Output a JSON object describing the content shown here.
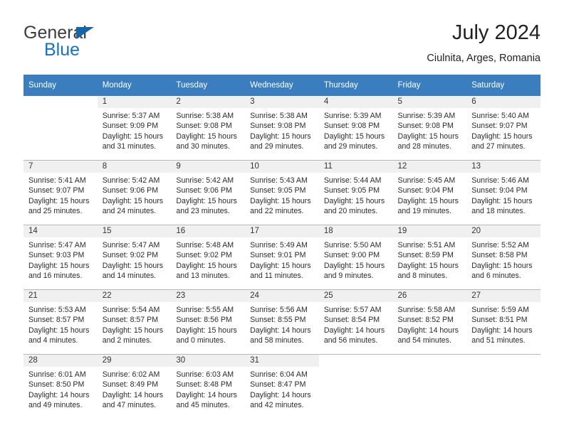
{
  "brand": {
    "name_part1": "General",
    "name_part2": "Blue",
    "flag_icon": "triangle-pennant-icon"
  },
  "header": {
    "title": "July 2024",
    "subtitle": "Ciulnita, Arges, Romania"
  },
  "colors": {
    "header_blue": "#3a7ebf",
    "brand_blue": "#1872bb",
    "daynum_band": "#f0f0f0",
    "row_divider": "#b9b9b9"
  },
  "weekday_headers": [
    "Sunday",
    "Monday",
    "Tuesday",
    "Wednesday",
    "Thursday",
    "Friday",
    "Saturday"
  ],
  "weeks": [
    [
      {
        "day": "",
        "lines": []
      },
      {
        "day": "1",
        "lines": [
          "Sunrise: 5:37 AM",
          "Sunset: 9:09 PM",
          "Daylight: 15 hours",
          "and 31 minutes."
        ]
      },
      {
        "day": "2",
        "lines": [
          "Sunrise: 5:38 AM",
          "Sunset: 9:08 PM",
          "Daylight: 15 hours",
          "and 30 minutes."
        ]
      },
      {
        "day": "3",
        "lines": [
          "Sunrise: 5:38 AM",
          "Sunset: 9:08 PM",
          "Daylight: 15 hours",
          "and 29 minutes."
        ]
      },
      {
        "day": "4",
        "lines": [
          "Sunrise: 5:39 AM",
          "Sunset: 9:08 PM",
          "Daylight: 15 hours",
          "and 29 minutes."
        ]
      },
      {
        "day": "5",
        "lines": [
          "Sunrise: 5:39 AM",
          "Sunset: 9:08 PM",
          "Daylight: 15 hours",
          "and 28 minutes."
        ]
      },
      {
        "day": "6",
        "lines": [
          "Sunrise: 5:40 AM",
          "Sunset: 9:07 PM",
          "Daylight: 15 hours",
          "and 27 minutes."
        ]
      }
    ],
    [
      {
        "day": "7",
        "lines": [
          "Sunrise: 5:41 AM",
          "Sunset: 9:07 PM",
          "Daylight: 15 hours",
          "and 25 minutes."
        ]
      },
      {
        "day": "8",
        "lines": [
          "Sunrise: 5:42 AM",
          "Sunset: 9:06 PM",
          "Daylight: 15 hours",
          "and 24 minutes."
        ]
      },
      {
        "day": "9",
        "lines": [
          "Sunrise: 5:42 AM",
          "Sunset: 9:06 PM",
          "Daylight: 15 hours",
          "and 23 minutes."
        ]
      },
      {
        "day": "10",
        "lines": [
          "Sunrise: 5:43 AM",
          "Sunset: 9:05 PM",
          "Daylight: 15 hours",
          "and 22 minutes."
        ]
      },
      {
        "day": "11",
        "lines": [
          "Sunrise: 5:44 AM",
          "Sunset: 9:05 PM",
          "Daylight: 15 hours",
          "and 20 minutes."
        ]
      },
      {
        "day": "12",
        "lines": [
          "Sunrise: 5:45 AM",
          "Sunset: 9:04 PM",
          "Daylight: 15 hours",
          "and 19 minutes."
        ]
      },
      {
        "day": "13",
        "lines": [
          "Sunrise: 5:46 AM",
          "Sunset: 9:04 PM",
          "Daylight: 15 hours",
          "and 18 minutes."
        ]
      }
    ],
    [
      {
        "day": "14",
        "lines": [
          "Sunrise: 5:47 AM",
          "Sunset: 9:03 PM",
          "Daylight: 15 hours",
          "and 16 minutes."
        ]
      },
      {
        "day": "15",
        "lines": [
          "Sunrise: 5:47 AM",
          "Sunset: 9:02 PM",
          "Daylight: 15 hours",
          "and 14 minutes."
        ]
      },
      {
        "day": "16",
        "lines": [
          "Sunrise: 5:48 AM",
          "Sunset: 9:02 PM",
          "Daylight: 15 hours",
          "and 13 minutes."
        ]
      },
      {
        "day": "17",
        "lines": [
          "Sunrise: 5:49 AM",
          "Sunset: 9:01 PM",
          "Daylight: 15 hours",
          "and 11 minutes."
        ]
      },
      {
        "day": "18",
        "lines": [
          "Sunrise: 5:50 AM",
          "Sunset: 9:00 PM",
          "Daylight: 15 hours",
          "and 9 minutes."
        ]
      },
      {
        "day": "19",
        "lines": [
          "Sunrise: 5:51 AM",
          "Sunset: 8:59 PM",
          "Daylight: 15 hours",
          "and 8 minutes."
        ]
      },
      {
        "day": "20",
        "lines": [
          "Sunrise: 5:52 AM",
          "Sunset: 8:58 PM",
          "Daylight: 15 hours",
          "and 6 minutes."
        ]
      }
    ],
    [
      {
        "day": "21",
        "lines": [
          "Sunrise: 5:53 AM",
          "Sunset: 8:57 PM",
          "Daylight: 15 hours",
          "and 4 minutes."
        ]
      },
      {
        "day": "22",
        "lines": [
          "Sunrise: 5:54 AM",
          "Sunset: 8:57 PM",
          "Daylight: 15 hours",
          "and 2 minutes."
        ]
      },
      {
        "day": "23",
        "lines": [
          "Sunrise: 5:55 AM",
          "Sunset: 8:56 PM",
          "Daylight: 15 hours",
          "and 0 minutes."
        ]
      },
      {
        "day": "24",
        "lines": [
          "Sunrise: 5:56 AM",
          "Sunset: 8:55 PM",
          "Daylight: 14 hours",
          "and 58 minutes."
        ]
      },
      {
        "day": "25",
        "lines": [
          "Sunrise: 5:57 AM",
          "Sunset: 8:54 PM",
          "Daylight: 14 hours",
          "and 56 minutes."
        ]
      },
      {
        "day": "26",
        "lines": [
          "Sunrise: 5:58 AM",
          "Sunset: 8:52 PM",
          "Daylight: 14 hours",
          "and 54 minutes."
        ]
      },
      {
        "day": "27",
        "lines": [
          "Sunrise: 5:59 AM",
          "Sunset: 8:51 PM",
          "Daylight: 14 hours",
          "and 51 minutes."
        ]
      }
    ],
    [
      {
        "day": "28",
        "lines": [
          "Sunrise: 6:01 AM",
          "Sunset: 8:50 PM",
          "Daylight: 14 hours",
          "and 49 minutes."
        ]
      },
      {
        "day": "29",
        "lines": [
          "Sunrise: 6:02 AM",
          "Sunset: 8:49 PM",
          "Daylight: 14 hours",
          "and 47 minutes."
        ]
      },
      {
        "day": "30",
        "lines": [
          "Sunrise: 6:03 AM",
          "Sunset: 8:48 PM",
          "Daylight: 14 hours",
          "and 45 minutes."
        ]
      },
      {
        "day": "31",
        "lines": [
          "Sunrise: 6:04 AM",
          "Sunset: 8:47 PM",
          "Daylight: 14 hours",
          "and 42 minutes."
        ]
      },
      {
        "day": "",
        "lines": []
      },
      {
        "day": "",
        "lines": []
      },
      {
        "day": "",
        "lines": []
      }
    ]
  ]
}
